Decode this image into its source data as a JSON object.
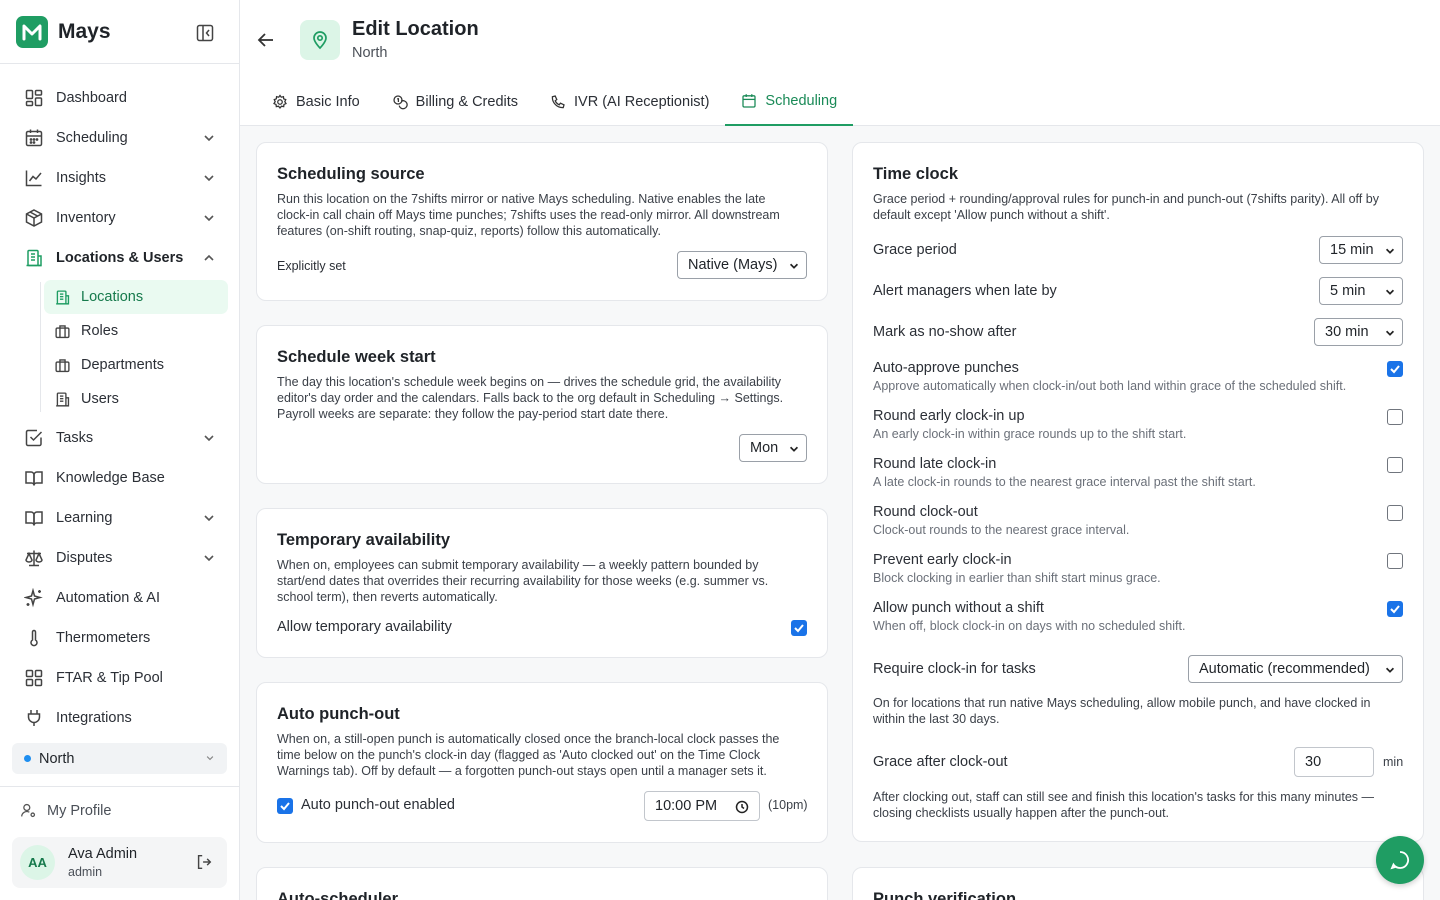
{
  "brand": {
    "name": "Mays",
    "logo_icon": "mays-logo-icon"
  },
  "sidebar": {
    "items": [
      {
        "label": "Dashboard",
        "icon": "dashboard-icon"
      },
      {
        "label": "Scheduling",
        "icon": "calendar-icon"
      },
      {
        "label": "Insights",
        "icon": "chart-line-icon"
      },
      {
        "label": "Inventory",
        "icon": "box-icon"
      },
      {
        "label": "Locations & Users",
        "icon": "building-icon"
      },
      {
        "label": "Tasks",
        "icon": "checkbox-icon"
      },
      {
        "label": "Knowledge Base",
        "icon": "book-icon"
      },
      {
        "label": "Learning",
        "icon": "book-open-icon"
      },
      {
        "label": "Disputes",
        "icon": "scale-icon"
      },
      {
        "label": "Automation & AI",
        "icon": "sparkle-icon"
      },
      {
        "label": "Thermometers",
        "icon": "thermometer-icon"
      },
      {
        "label": "FTAR & Tip Pool",
        "icon": "grid-icon"
      },
      {
        "label": "Integrations",
        "icon": "plug-icon"
      }
    ],
    "sub_items": [
      {
        "label": "Locations",
        "icon": "building-icon"
      },
      {
        "label": "Roles",
        "icon": "briefcase-icon"
      },
      {
        "label": "Departments",
        "icon": "briefcase-icon"
      },
      {
        "label": "Users",
        "icon": "building-icon"
      }
    ],
    "location_switcher": "North",
    "my_profile": "My Profile",
    "user": {
      "initials": "AA",
      "name": "Ava Admin",
      "role": "admin"
    }
  },
  "header": {
    "title": "Edit Location",
    "subtitle": "North",
    "tabs": [
      {
        "label": "Basic Info",
        "icon": "gear-icon"
      },
      {
        "label": "Billing & Credits",
        "icon": "coins-icon"
      },
      {
        "label": "IVR (AI Receptionist)",
        "icon": "phone-icon"
      },
      {
        "label": "Scheduling",
        "icon": "calendar-icon"
      }
    ],
    "active_tab": "Scheduling"
  },
  "cards": {
    "scheduling_source": {
      "title": "Scheduling source",
      "desc_lines": [
        "Run this location on the 7shifts mirror or native Mays scheduling. Native enables the late",
        "clock-in call chain off Mays time punches; 7shifts uses the read-only mirror. All downstream",
        "features (on-shift routing, snap-quiz, reports) follow this automatically."
      ],
      "label": "Explicitly set",
      "value": "Native (Mays)"
    },
    "week_start": {
      "title": "Schedule week start",
      "desc_lines": [
        "The day this location's schedule week begins on — drives the schedule grid, the availability",
        "editor's day order and the calendars. Falls back to the org default in Scheduling → Settings.",
        "Payroll weeks are separate: they follow the pay-period start date there."
      ],
      "value": "Mon"
    },
    "temp_availability": {
      "title": "Temporary availability",
      "desc_lines": [
        "When on, employees can submit temporary availability — a weekly pattern bounded by",
        "start/end dates that overrides their recurring availability for those weeks (e.g. summer vs.",
        "school term), then reverts automatically."
      ],
      "label": "Allow temporary availability",
      "checked": true
    },
    "auto_punch_out": {
      "title": "Auto punch-out",
      "desc_lines": [
        "When on, a still-open punch is automatically closed once the branch-local clock passes the",
        "time below on the punch's clock-in day (flagged as 'Auto clocked out' on the Time Clock",
        "Warnings tab). Off by default — a forgotten punch-out stays open until a manager sets it."
      ],
      "label": "Auto punch-out enabled",
      "checked": true,
      "time": "10:00 PM",
      "time_note": "(10pm)"
    },
    "auto_scheduler": {
      "title": "Auto-scheduler"
    },
    "time_clock": {
      "title": "Time clock",
      "desc_lines": [
        "Grace period + rounding/approval rules for punch-in and punch-out (7shifts parity). All off by",
        "default except 'Allow punch without a shift'."
      ],
      "selects": [
        {
          "label": "Grace period",
          "value": "15 min"
        },
        {
          "label": "Alert managers when late by",
          "value": "5 min"
        },
        {
          "label": "Mark as no-show after",
          "value": "30 min"
        }
      ],
      "toggles": [
        {
          "label": "Auto-approve punches",
          "help": "Approve automatically when clock-in/out both land within grace of the scheduled shift.",
          "checked": true
        },
        {
          "label": "Round early clock-in up",
          "help": "An early clock-in within grace rounds up to the shift start.",
          "checked": false
        },
        {
          "label": "Round late clock-in",
          "help": "A late clock-in rounds to the nearest grace interval past the shift start.",
          "checked": false
        },
        {
          "label": "Round clock-out",
          "help": "Clock-out rounds to the nearest grace interval.",
          "checked": false
        },
        {
          "label": "Prevent early clock-in",
          "help": "Block clocking in earlier than shift start minus grace.",
          "checked": false
        },
        {
          "label": "Allow punch without a shift",
          "help": "When off, block clock-in on days with no scheduled shift.",
          "checked": true
        }
      ],
      "require_clockin": {
        "label": "Require clock-in for tasks",
        "value": "Automatic (recommended)",
        "note_lines": [
          "On for locations that run native Mays scheduling, allow mobile punch, and have clocked in",
          "within the last 30 days."
        ]
      },
      "grace_after": {
        "label": "Grace after clock-out",
        "value": "30",
        "unit": "min",
        "note_lines": [
          "After clocking out, staff can still see and finish this location's tasks for this many minutes —",
          "closing checklists usually happen after the punch-out."
        ]
      }
    },
    "punch_verification": {
      "title": "Punch verification"
    }
  },
  "colors": {
    "accent": "#1f9d63",
    "checkbox": "#1a73e8"
  }
}
